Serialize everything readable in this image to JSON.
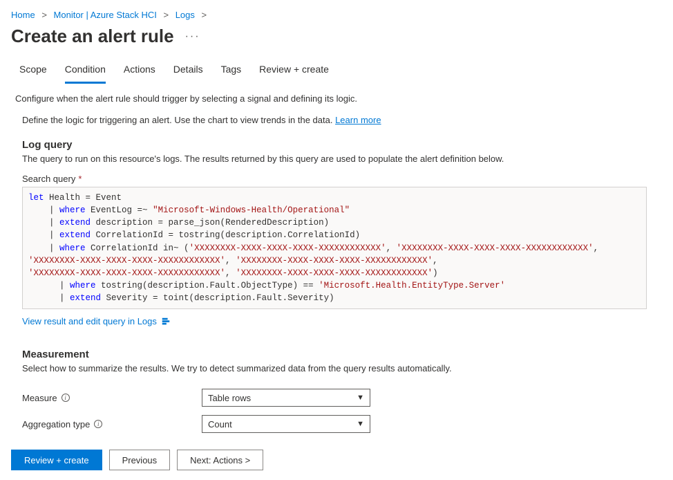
{
  "breadcrumbs": [
    "Home",
    "Monitor | Azure Stack HCI",
    "Logs"
  ],
  "page_title": "Create an alert rule",
  "tabs": [
    "Scope",
    "Condition",
    "Actions",
    "Details",
    "Tags",
    "Review + create"
  ],
  "active_tab_index": 1,
  "desc_main": "Configure when the alert rule should trigger by selecting a signal and defining its logic.",
  "desc_sub": "Define the logic for triggering an alert. Use the chart to view trends in the data. ",
  "learn_more": "Learn more",
  "log_query": {
    "heading": "Log query",
    "desc": "The query to run on this resource's logs. The results returned by this query are used to populate the alert definition below.",
    "label": "Search query",
    "code": {
      "l1_a": "let",
      "l1_b": " Health = Event",
      "l2_a": "where",
      "l2_b": " EventLog =~ ",
      "l2_c": "\"Microsoft-Windows-Health/Operational\"",
      "l3_a": "extend",
      "l3_b": " description = parse_json(RenderedDescription)",
      "l4_a": "extend",
      "l4_b": " CorrelationId = tostring(description.CorrelationId)",
      "l5_a": "where",
      "l5_b": " CorrelationId in~ (",
      "l5_c": "'XXXXXXXX-XXXX-XXXX-XXXX-XXXXXXXXXXXX'",
      "l5_d": ", ",
      "l5_e": "'XXXXXXXX-XXXX-XXXX-XXXX-XXXXXXXXXXXX'",
      "l5_f": ",",
      "l6_a": "'XXXXXXXX-XXXX-XXXX-XXXX-XXXXXXXXXXXX'",
      "l6_b": ", ",
      "l6_c": "'XXXXXXXX-XXXX-XXXX-XXXX-XXXXXXXXXXXX'",
      "l6_d": ",",
      "l7_a": "'XXXXXXXX-XXXX-XXXX-XXXX-XXXXXXXXXXXX'",
      "l7_b": ", ",
      "l7_c": "'XXXXXXXX-XXXX-XXXX-XXXX-XXXXXXXXXXXX'",
      "l7_d": ")",
      "l8_a": "where",
      "l8_b": " tostring(description.Fault.ObjectType) == ",
      "l8_c": "'Microsoft.Health.EntityType.Server'",
      "l9_a": "extend",
      "l9_b": " Severity = toint(description.Fault.Severity)"
    },
    "view_link": "View result and edit query in Logs"
  },
  "measurement": {
    "heading": "Measurement",
    "desc": "Select how to summarize the results. We try to detect summarized data from the query results automatically.",
    "measure_label": "Measure",
    "measure_value": "Table rows",
    "agg_label": "Aggregation type",
    "agg_value": "Count"
  },
  "footer": {
    "review": "Review + create",
    "prev": "Previous",
    "next": "Next: Actions >"
  }
}
